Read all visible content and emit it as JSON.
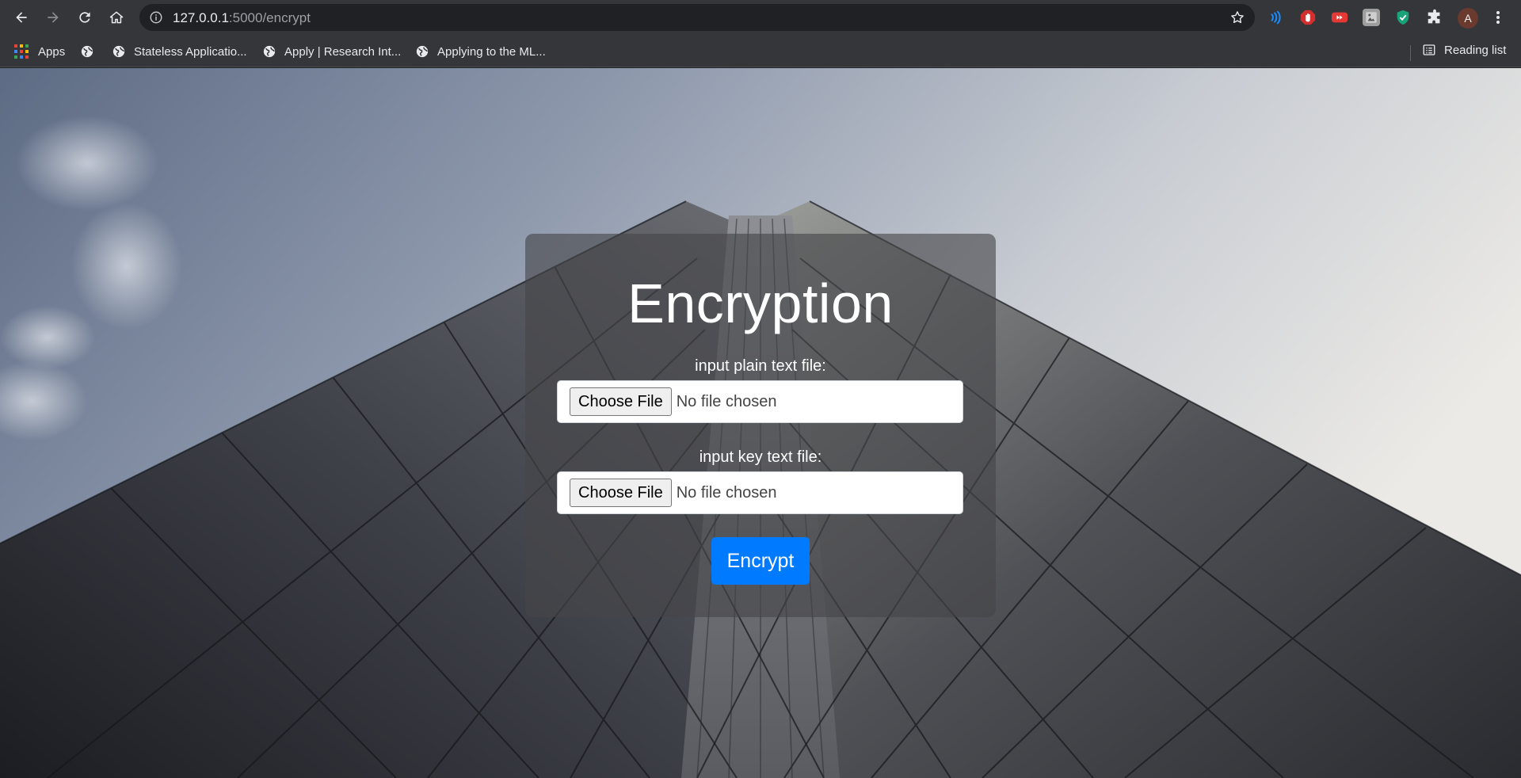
{
  "browser": {
    "url_host": "127.0.0.1",
    "url_path": ":5000/encrypt",
    "avatar_letter": "A",
    "bookmarks": [
      {
        "label": "Apps",
        "icon": "apps-grid-icon"
      },
      {
        "label": "",
        "icon": "globe-icon"
      },
      {
        "label": "Stateless Applicatio...",
        "icon": "globe-icon"
      },
      {
        "label": "Apply | Research Int...",
        "icon": "globe-icon"
      },
      {
        "label": "Applying to the ML...",
        "icon": "globe-icon"
      }
    ],
    "reading_list": "Reading list",
    "extensions": [
      "wifi-waves-icon",
      "stop-hand-icon",
      "youtube-icon",
      "puzzle-photo-icon",
      "shield-check-icon",
      "puzzle-icon"
    ]
  },
  "page": {
    "title": "Encryption",
    "plain_label": "input plain text file:",
    "key_label": "input key text file:",
    "choose_file": "Choose File",
    "no_file": "No file chosen",
    "encrypt_button": "Encrypt"
  },
  "colors": {
    "accent": "#007bff",
    "chrome": "#35363a"
  }
}
